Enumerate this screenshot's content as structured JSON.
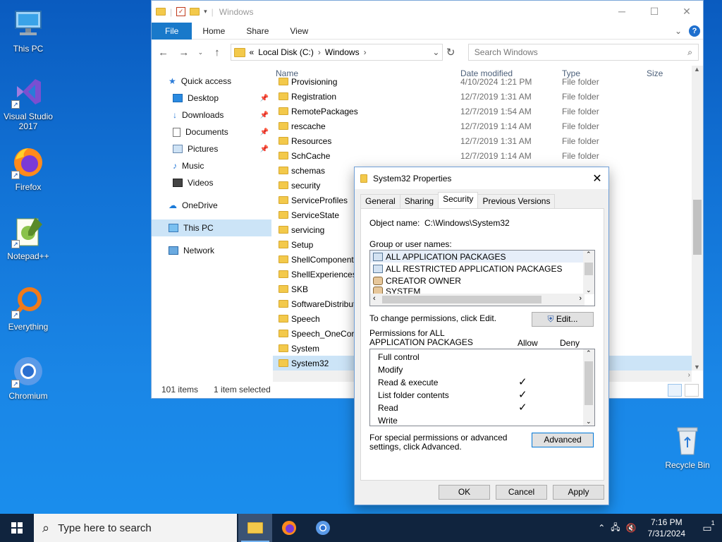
{
  "desktop": {
    "icons": [
      {
        "label": "This PC"
      },
      {
        "label": "Visual Studio 2017"
      },
      {
        "label": "Firefox"
      },
      {
        "label": "Notepad++"
      },
      {
        "label": "Everything"
      },
      {
        "label": "Chromium"
      },
      {
        "label": "Recycle Bin"
      }
    ]
  },
  "explorer": {
    "title": "Windows",
    "ribbon": {
      "file": "File",
      "home": "Home",
      "share": "Share",
      "view": "View",
      "help": "?"
    },
    "address": {
      "prefix": "«",
      "crumb1": "Local Disk (C:)",
      "crumb2": "Windows"
    },
    "search": {
      "placeholder": "Search Windows"
    },
    "nav": {
      "quick_access": "Quick access",
      "desktop": "Desktop",
      "downloads": "Downloads",
      "documents": "Documents",
      "pictures": "Pictures",
      "music": "Music",
      "videos": "Videos",
      "onedrive": "OneDrive",
      "this_pc": "This PC",
      "network": "Network"
    },
    "columns": {
      "name": "Name",
      "date": "Date modified",
      "type": "Type",
      "size": "Size"
    },
    "files": [
      {
        "name": "Provisioning",
        "date": "4/10/2024 1:21 PM",
        "type": "File folder"
      },
      {
        "name": "Registration",
        "date": "12/7/2019 1:31 AM",
        "type": "File folder"
      },
      {
        "name": "RemotePackages",
        "date": "12/7/2019 1:54 AM",
        "type": "File folder"
      },
      {
        "name": "rescache",
        "date": "12/7/2019 1:14 AM",
        "type": "File folder"
      },
      {
        "name": "Resources",
        "date": "12/7/2019 1:31 AM",
        "type": "File folder"
      },
      {
        "name": "SchCache",
        "date": "12/7/2019 1:14 AM",
        "type": "File folder"
      },
      {
        "name": "schemas",
        "date": "",
        "type": ""
      },
      {
        "name": "security",
        "date": "",
        "type": ""
      },
      {
        "name": "ServiceProfiles",
        "date": "",
        "type": ""
      },
      {
        "name": "ServiceState",
        "date": "",
        "type": ""
      },
      {
        "name": "servicing",
        "date": "",
        "type": ""
      },
      {
        "name": "Setup",
        "date": "",
        "type": ""
      },
      {
        "name": "ShellComponents",
        "date": "",
        "type": ""
      },
      {
        "name": "ShellExperiences",
        "date": "",
        "type": ""
      },
      {
        "name": "SKB",
        "date": "",
        "type": ""
      },
      {
        "name": "SoftwareDistribution",
        "date": "",
        "type": ""
      },
      {
        "name": "Speech",
        "date": "",
        "type": ""
      },
      {
        "name": "Speech_OneCore",
        "date": "",
        "type": ""
      },
      {
        "name": "System",
        "date": "",
        "type": ""
      },
      {
        "name": "System32",
        "date": "",
        "type": ""
      }
    ],
    "status": {
      "items": "101 items",
      "selected": "1 item selected"
    }
  },
  "dialog": {
    "title": "System32 Properties",
    "tabs": [
      "General",
      "Sharing",
      "Security",
      "Previous Versions"
    ],
    "active_tab": "Security",
    "object_name_label": "Object name:",
    "object_name": "C:\\Windows\\System32",
    "group_label": "Group or user names:",
    "groups": [
      "ALL APPLICATION PACKAGES",
      "ALL RESTRICTED APPLICATION PACKAGES",
      "CREATOR OWNER",
      "SYSTEM"
    ],
    "change_label": "To change permissions, click Edit.",
    "edit_button": "Edit...",
    "perm_for": "Permissions for ALL APPLICATION PACKAGES",
    "allow": "Allow",
    "deny": "Deny",
    "permissions": [
      {
        "name": "Full control",
        "allow": ""
      },
      {
        "name": "Modify",
        "allow": ""
      },
      {
        "name": "Read & execute",
        "allow": "✓"
      },
      {
        "name": "List folder contents",
        "allow": "✓"
      },
      {
        "name": "Read",
        "allow": "✓"
      },
      {
        "name": "Write",
        "allow": ""
      }
    ],
    "special_label": "For special permissions or advanced settings, click Advanced.",
    "advanced_button": "Advanced",
    "ok": "OK",
    "cancel": "Cancel",
    "apply": "Apply"
  },
  "taskbar": {
    "search_placeholder": "Type here to search",
    "time": "7:16 PM",
    "date": "7/31/2024",
    "notif_count": "1"
  }
}
